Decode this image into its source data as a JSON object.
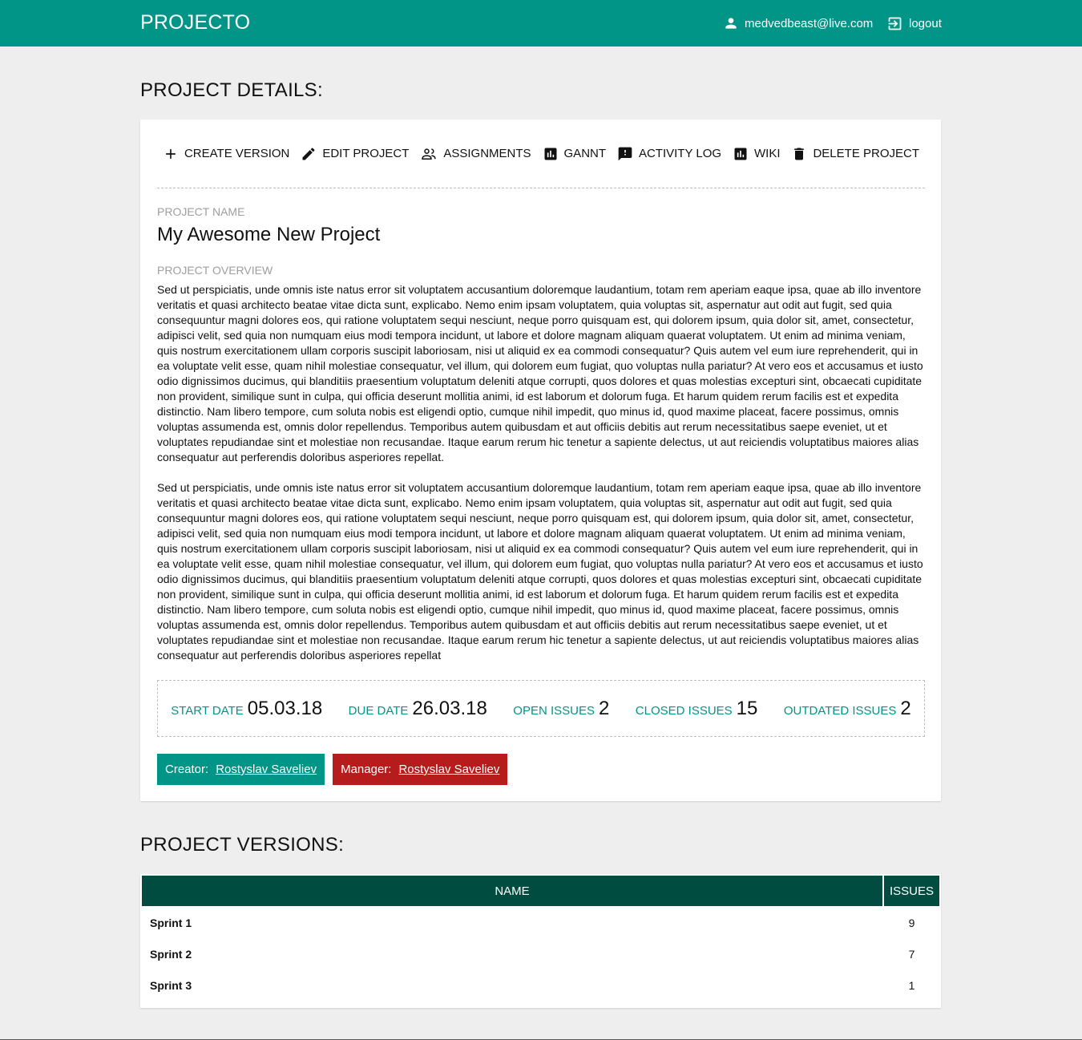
{
  "header": {
    "brand": "PROJECTO",
    "user_email": "medvedbeast@live.com",
    "logout_label": "logout"
  },
  "details": {
    "title": "PROJECT DETAILS:",
    "toolbar": {
      "create_version": "CREATE VERSION",
      "edit_project": "EDIT PROJECT",
      "assignments": "ASSIGNMENTS",
      "gannt": "GANNT",
      "activity_log": "ACTIVITY LOG",
      "wiki": "WIKI",
      "delete_project": "DELETE PROJECT"
    },
    "name_label": "PROJECT NAME",
    "name_value": "My Awesome New Project",
    "overview_label": "PROJECT OVERVIEW",
    "overview_paragraphs": [
      "Sed ut perspiciatis, unde omnis iste natus error sit voluptatem accusantium doloremque laudantium, totam rem aperiam eaque ipsa, quae ab illo inventore veritatis et quasi architecto beatae vitae dicta sunt, explicabo. Nemo enim ipsam voluptatem, quia voluptas sit, aspernatur aut odit aut fugit, sed quia consequuntur magni dolores eos, qui ratione voluptatem sequi nesciunt, neque porro quisquam est, qui dolorem ipsum, quia dolor sit, amet, consectetur, adipisci velit, sed quia non numquam eius modi tempora incidunt, ut labore et dolore magnam aliquam quaerat voluptatem. Ut enim ad minima veniam, quis nostrum exercitationem ullam corporis suscipit laboriosam, nisi ut aliquid ex ea commodi consequatur? Quis autem vel eum iure reprehenderit, qui in ea voluptate velit esse, quam nihil molestiae consequatur, vel illum, qui dolorem eum fugiat, quo voluptas nulla pariatur? At vero eos et accusamus et iusto odio dignissimos ducimus, qui blanditiis praesentium voluptatum deleniti atque corrupti, quos dolores et quas molestias excepturi sint, obcaecati cupiditate non provident, similique sunt in culpa, qui officia deserunt mollitia animi, id est laborum et dolorum fuga. Et harum quidem rerum facilis est et expedita distinctio. Nam libero tempore, cum soluta nobis est eligendi optio, cumque nihil impedit, quo minus id, quod maxime placeat, facere possimus, omnis voluptas assumenda est, omnis dolor repellendus. Temporibus autem quibusdam et aut officiis debitis aut rerum necessitatibus saepe eveniet, ut et voluptates repudiandae sint et molestiae non recusandae. Itaque earum rerum hic tenetur a sapiente delectus, ut aut reiciendis voluptatibus maiores alias consequatur aut perferendis doloribus asperiores repellat.",
      "Sed ut perspiciatis, unde omnis iste natus error sit voluptatem accusantium doloremque laudantium, totam rem aperiam eaque ipsa, quae ab illo inventore veritatis et quasi architecto beatae vitae dicta sunt, explicabo. Nemo enim ipsam voluptatem, quia voluptas sit, aspernatur aut odit aut fugit, sed quia consequuntur magni dolores eos, qui ratione voluptatem sequi nesciunt, neque porro quisquam est, qui dolorem ipsum, quia dolor sit, amet, consectetur, adipisci velit, sed quia non numquam eius modi tempora incidunt, ut labore et dolore magnam aliquam quaerat voluptatem. Ut enim ad minima veniam, quis nostrum exercitationem ullam corporis suscipit laboriosam, nisi ut aliquid ex ea commodi consequatur? Quis autem vel eum iure reprehenderit, qui in ea voluptate velit esse, quam nihil molestiae consequatur, vel illum, qui dolorem eum fugiat, quo voluptas nulla pariatur? At vero eos et accusamus et iusto odio dignissimos ducimus, qui blanditiis praesentium voluptatum deleniti atque corrupti, quos dolores et quas molestias excepturi sint, obcaecati cupiditate non provident, similique sunt in culpa, qui officia deserunt mollitia animi, id est laborum et dolorum fuga. Et harum quidem rerum facilis est et expedita distinctio. Nam libero tempore, cum soluta nobis est eligendi optio, cumque nihil impedit, quo minus id, quod maxime placeat, facere possimus, omnis voluptas assumenda est, omnis dolor repellendus. Temporibus autem quibusdam et aut officiis debitis aut rerum necessitatibus saepe eveniet, ut et voluptates repudiandae sint et molestiae non recusandae. Itaque earum rerum hic tenetur a sapiente delectus, ut aut reiciendis voluptatibus maiores alias consequatur aut perferendis doloribus asperiores repellat"
    ],
    "stats": {
      "start_date_label": "START DATE",
      "start_date_value": "05.03.18",
      "due_date_label": "DUE DATE",
      "due_date_value": "26.03.18",
      "open_issues_label": "OPEN ISSUES",
      "open_issues_value": "2",
      "closed_issues_label": "CLOSED ISSUES",
      "closed_issues_value": "15",
      "outdated_issues_label": "OUTDATED ISSUES",
      "outdated_issues_value": "2"
    },
    "creator_label": "Creator:",
    "creator_name": "Rostyslav Saveliev",
    "manager_label": "Manager:",
    "manager_name": "Rostyslav Saveliev"
  },
  "versions": {
    "title": "PROJECT VERSIONS:",
    "columns": {
      "name": "NAME",
      "issues": "ISSUES"
    },
    "rows": [
      {
        "name": "Sprint 1",
        "issues": "9"
      },
      {
        "name": "Sprint 2",
        "issues": "7"
      },
      {
        "name": "Sprint 3",
        "issues": "1"
      }
    ]
  },
  "colors": {
    "brand_teal": "#009587",
    "table_header": "#004c40",
    "manager_red": "#b71c1c",
    "page_background": "#eeeeee"
  },
  "icons": {
    "user": "person-icon",
    "logout": "logout-icon",
    "create_version": "plus-icon",
    "edit_project": "pencil-icon",
    "assignments": "people-icon",
    "gannt": "bar-chart-icon",
    "activity_log": "feedback-icon",
    "wiki": "bar-chart-icon",
    "delete_project": "trash-icon"
  }
}
